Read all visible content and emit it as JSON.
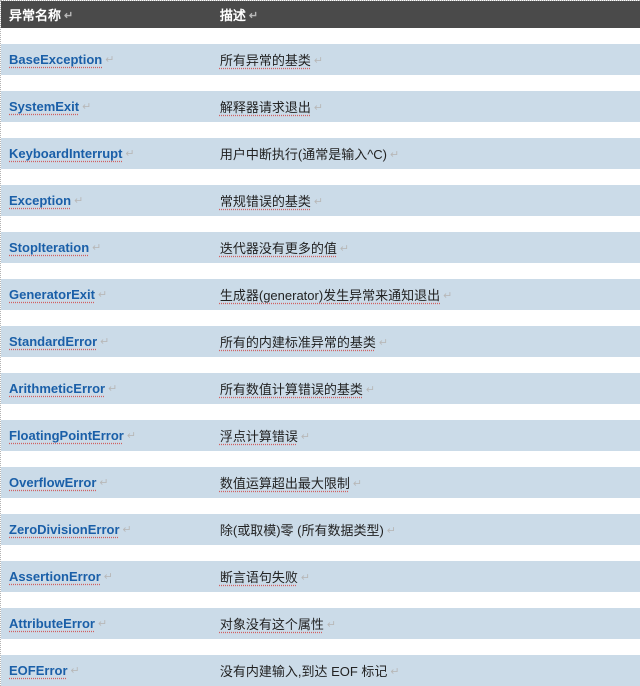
{
  "header": {
    "name": "异常名称",
    "desc": "描述"
  },
  "rows": [
    {
      "name": "BaseException",
      "desc": "所有异常的基类",
      "plainDesc": false
    },
    {
      "name": "SystemExit",
      "desc": "解释器请求退出",
      "plainDesc": false
    },
    {
      "name": "KeyboardInterrupt",
      "desc": "用户中断执行(通常是输入^C)",
      "plainDesc": true
    },
    {
      "name": "Exception",
      "desc": "常规错误的基类",
      "plainDesc": false
    },
    {
      "name": "StopIteration",
      "desc": "迭代器没有更多的值",
      "plainDesc": false
    },
    {
      "name": "GeneratorExit",
      "desc": "生成器(generator)发生异常来通知退出",
      "plainDesc": false
    },
    {
      "name": "StandardError",
      "desc": "所有的内建标准异常的基类",
      "plainDesc": false
    },
    {
      "name": "ArithmeticError",
      "desc": "所有数值计算错误的基类",
      "plainDesc": false
    },
    {
      "name": "FloatingPointError",
      "desc": "浮点计算错误",
      "plainDesc": false
    },
    {
      "name": "OverflowError",
      "desc": "数值运算超出最大限制",
      "plainDesc": false
    },
    {
      "name": "ZeroDivisionError",
      "desc": "除(或取模)零 (所有数据类型)",
      "plainDesc": true
    },
    {
      "name": "AssertionError",
      "desc": "断言语句失败",
      "plainDesc": false
    },
    {
      "name": "AttributeError",
      "desc": "对象没有这个属性",
      "plainDesc": false
    },
    {
      "name": "EOFError",
      "desc": "没有内建输入,到达 EOF 标记",
      "plainDesc": true
    }
  ],
  "arrow": "↵"
}
